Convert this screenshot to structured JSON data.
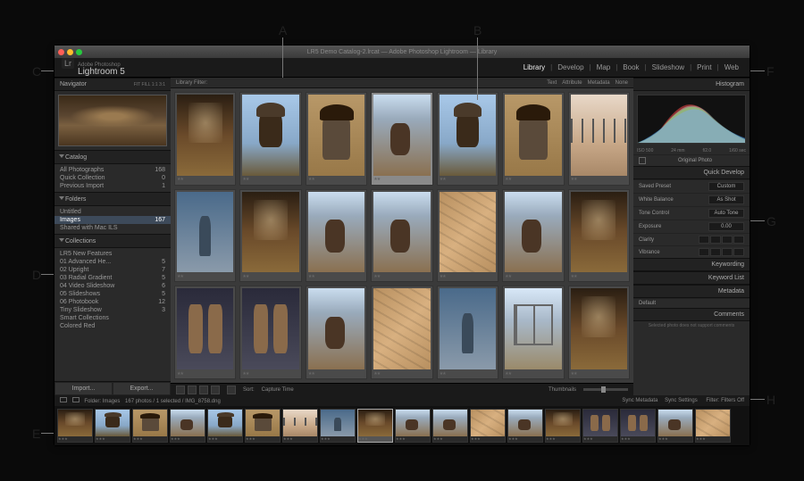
{
  "annotations": {
    "A": "A",
    "B": "B",
    "C": "C",
    "D": "D",
    "E": "E",
    "F": "F",
    "G": "G",
    "H": "H"
  },
  "window": {
    "title": "LR5 Demo Catalog-2.lrcat — Adobe Photoshop Lightroom — Library"
  },
  "brand": {
    "badge": "Lr",
    "sub": "Adobe Photoshop",
    "main": "Lightroom 5"
  },
  "modules": [
    "Library",
    "Develop",
    "Map",
    "Book",
    "Slideshow",
    "Print",
    "Web"
  ],
  "active_module": "Library",
  "left": {
    "navigator": {
      "title": "Navigator",
      "zoom": [
        "FIT",
        "FILL",
        "1:1",
        "3:1"
      ]
    },
    "catalog": {
      "title": "Catalog",
      "items": [
        {
          "label": "All Photographs",
          "count": "168"
        },
        {
          "label": "Quick Collection",
          "count": "0"
        },
        {
          "label": "Previous Import",
          "count": "1"
        }
      ]
    },
    "folders": {
      "title": "Folders",
      "items": [
        {
          "label": "Untitled",
          "count": ""
        },
        {
          "label": "Images",
          "count": "167",
          "sel": true
        },
        {
          "label": "Shared with Mac ILS",
          "count": ""
        }
      ]
    },
    "collections": {
      "title": "Collections",
      "items": [
        {
          "label": "LR5 New Features",
          "count": ""
        },
        {
          "label": "01 Advanced He...",
          "count": "5"
        },
        {
          "label": "02 Upright",
          "count": "7"
        },
        {
          "label": "03 Radial Gradient",
          "count": "5"
        },
        {
          "label": "04 Video Slideshow",
          "count": "6"
        },
        {
          "label": "05 Slideshows",
          "count": "5"
        },
        {
          "label": "06 Photobook",
          "count": "12"
        },
        {
          "label": "Tiny Slideshow",
          "count": "3"
        },
        {
          "label": "Smart Collections",
          "count": ""
        },
        {
          "label": "Colored Red",
          "count": ""
        }
      ]
    },
    "import": "Import...",
    "export": "Export..."
  },
  "filterbar": {
    "title": "Library Filter:",
    "tabs": [
      "Text",
      "Attribute",
      "Metadata",
      "None"
    ],
    "right": "Filters Off"
  },
  "right": {
    "histogram": {
      "title": "Histogram",
      "iso": "ISO 500",
      "focal": "24 mm",
      "ap": "f/2.0",
      "shutter": "1/60 sec"
    },
    "orig": "Original Photo",
    "quickdevelop": {
      "title": "Quick Develop",
      "rows": [
        {
          "label": "Saved Preset",
          "value": "Custom"
        },
        {
          "label": "White Balance",
          "value": "As Shot"
        },
        {
          "label": "Tone Control",
          "value": "Auto Tone"
        },
        {
          "label": "Exposure",
          "value": "0.00"
        },
        {
          "label": "Clarity",
          "value": ""
        },
        {
          "label": "Vibrance",
          "value": ""
        }
      ]
    },
    "panels": [
      "Keywording",
      "Keyword List",
      "Metadata",
      "Comments"
    ],
    "metadata_preset": "Default",
    "comment_note": "Selected photo does not support comments"
  },
  "toolbar": {
    "sort_label": "Sort:",
    "sort_value": "Capture Time",
    "thumb_label": "Thumbnails"
  },
  "filmstrip": {
    "nav_label": "Folder: Images",
    "count": "167 photos / 1 selected / IMG_8758.dng",
    "filter_label": "Filter:",
    "filter_value": "Filters Off",
    "sync": "Sync Metadata",
    "settings": "Sync Settings"
  },
  "grid_thumbs": [
    "arena",
    "cowboy",
    "portrait",
    "rider",
    "cowboy",
    "portrait",
    "fence",
    "walk",
    "arena",
    "rider",
    "rider",
    "floor",
    "rider",
    "arena",
    "boots",
    "boots",
    "rider",
    "floor",
    "walk",
    "gate",
    "arena"
  ],
  "film_thumbs": [
    "arena",
    "cowboy",
    "portrait",
    "rider",
    "cowboy",
    "portrait",
    "fence",
    "walk",
    "arena",
    "rider",
    "rider",
    "floor",
    "rider",
    "arena",
    "boots",
    "boots",
    "rider",
    "floor"
  ]
}
